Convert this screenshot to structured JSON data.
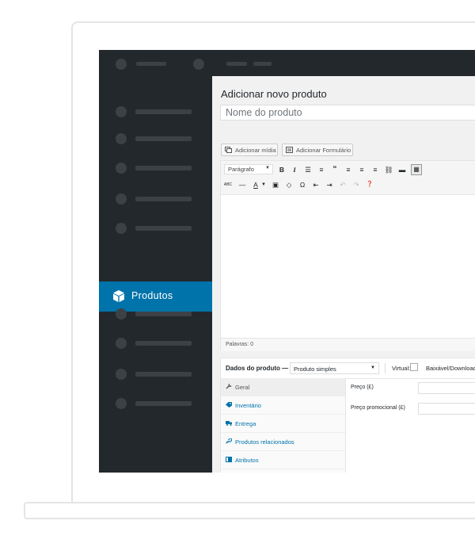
{
  "sidebar": {
    "active_item_label": "Produtos",
    "active_item_icon": "box-icon"
  },
  "page": {
    "title": "Adicionar novo produto",
    "name_placeholder": "Nome do produto"
  },
  "media_buttons": {
    "add_media": "Adicionar mídia",
    "add_form": "Adicionar Formulário"
  },
  "editor": {
    "format_select": "Parágrafo",
    "toolbar_row1": [
      "B",
      "I",
      "bullet-list-icon",
      "numbered-list-icon",
      "quote-icon",
      "align-left-icon",
      "align-center-icon",
      "align-right-icon",
      "link-icon",
      "read-more-icon",
      "toolbar-toggle-icon"
    ],
    "toolbar_row2": [
      "strikethrough-icon",
      "horizontal-line-icon",
      "text-color-icon",
      "paste-text-icon",
      "clear-formatting-icon",
      "special-character-icon",
      "outdent-icon",
      "indent-icon",
      "undo-icon",
      "redo-icon",
      "help-icon"
    ],
    "word_count": "Palavras: 0"
  },
  "product_data": {
    "label": "Dados do produto —",
    "type_select": "Produto simples",
    "virtual_label": "Virtual:",
    "downloadable_label": "Baixável/Download:",
    "tabs": [
      {
        "label": "Geral",
        "icon": "wrench-icon"
      },
      {
        "label": "Inventário",
        "icon": "tag-icon"
      },
      {
        "label": "Entrega",
        "icon": "truck-icon"
      },
      {
        "label": "Produtos relacionados",
        "icon": "link-icon"
      },
      {
        "label": "Atributos",
        "icon": "table-icon"
      }
    ],
    "fields": [
      {
        "label": "Preço (£)"
      },
      {
        "label": "Preço promocional (£)"
      }
    ]
  },
  "colors": {
    "admin_dark": "#23282d",
    "accent": "#0073aa",
    "placeholder_bar": "#3c4146"
  }
}
